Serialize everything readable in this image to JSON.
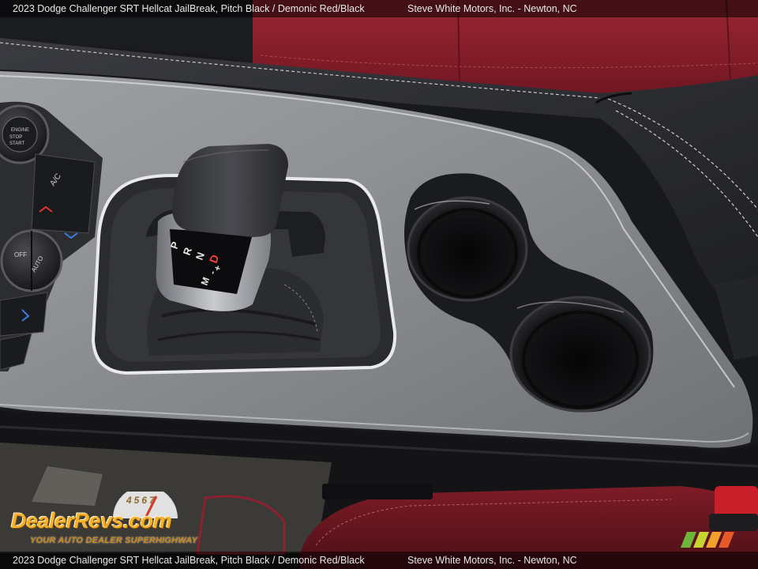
{
  "caption": {
    "vehicle": "2023 Dodge Challenger SRT Hellcat JailBreak,  Pitch Black / Demonic Red/Black",
    "dealer": "Steve White Motors, Inc. - Newton, NC"
  },
  "watermark": {
    "brand": "DealerRevs.com",
    "tagline": "YOUR AUTO DEALER SUPERHIGHWAY",
    "gauge_digits": "4567",
    "colors": {
      "brand": "#f4b12f",
      "stripe_1": "#6fb53b",
      "stripe_2": "#c7d431",
      "stripe_3": "#f2a12a",
      "stripe_4": "#e65a2a"
    }
  },
  "photo": {
    "subject": "center console with gear shifter and cupholders",
    "shifter_positions": [
      "P",
      "R",
      "N",
      "D",
      "M",
      "-",
      "+"
    ],
    "active_position": "D",
    "left_button_labels": [
      "ENGINE STOP START",
      "A/C",
      "AUTO",
      "OFF"
    ],
    "colors": {
      "console_trim": "#8a8c90",
      "leather_red": "#8c1e2a",
      "leather_black": "#222327",
      "gear_indicator_active": "#ff3b3b"
    }
  }
}
